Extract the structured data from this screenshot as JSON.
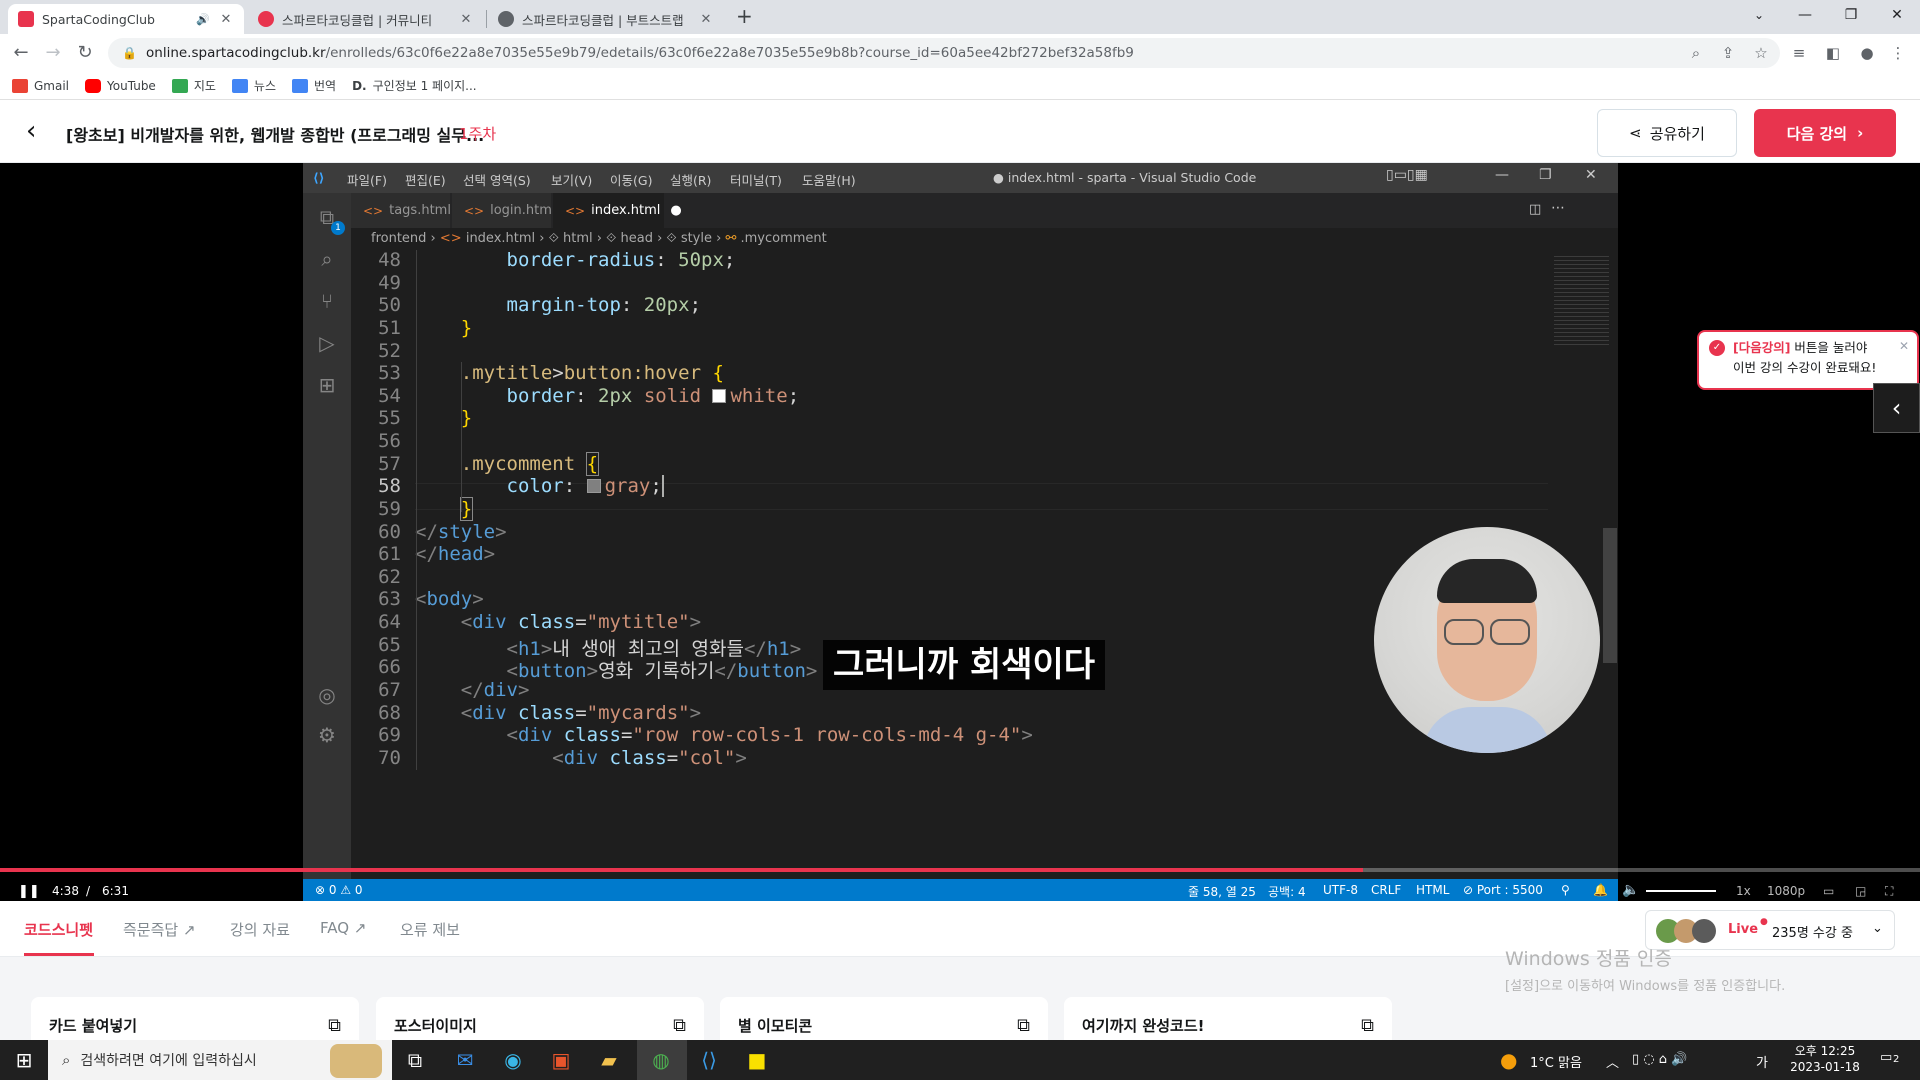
{
  "browser": {
    "tabs": [
      {
        "title": "SpartaCodingClub",
        "favicon_color": "#e8344e"
      },
      {
        "title": "스파르타코딩클럽 | 커뮤니티",
        "favicon_color": "#e8344e"
      },
      {
        "title": "스파르타코딩클럽 | 부트스트랩",
        "favicon_color": "#5f6368"
      }
    ],
    "new_tab": "+",
    "url_host": "online.spartacodingclub.kr",
    "url_path": "/enrolleds/63c0f6e22a8e7035e55e9b79/edetails/63c0f6e22a8e7035e55e9b8b?course_id=60a5ee42bf272bef32a58fb9",
    "bookmarks": [
      {
        "label": "Gmail",
        "color": "#ea4335"
      },
      {
        "label": "YouTube",
        "color": "#ff0000"
      },
      {
        "label": "지도",
        "color": "#34a853"
      },
      {
        "label": "뉴스",
        "color": "#4285f4"
      },
      {
        "label": "번역",
        "color": "#4285f4"
      },
      {
        "label": "구인정보 1 페이지...",
        "color": "#000000",
        "prefix": "D."
      }
    ]
  },
  "course": {
    "title": "[왕초보] 비개발자를 위한, 웹개발 종합반 (프로그래밍 실무...",
    "week": "1주차",
    "share_label": "공유하기",
    "next_label": "다음 강의",
    "tooltip_bold": "[다음강의]",
    "tooltip_rest": " 버튼을 눌러야",
    "tooltip_line2": "이번 강의 수강이 완료돼요!"
  },
  "vscode": {
    "menus": [
      "파일(F)",
      "편집(E)",
      "선택 영역(S)",
      "보기(V)",
      "이동(G)",
      "실행(R)",
      "터미널(T)",
      "도움말(H)"
    ],
    "window_title": "● index.html - sparta - Visual Studio Code",
    "tabs": [
      "tags.html",
      "login.html",
      "index.html"
    ],
    "breadcrumbs": [
      "frontend",
      "index.html",
      "html",
      "head",
      "style",
      ".mycomment"
    ],
    "explorer_badge": "1",
    "line_numbers": [
      "48",
      "49",
      "50",
      "51",
      "52",
      "53",
      "54",
      "55",
      "56",
      "57",
      "58",
      "59",
      "60",
      "61",
      "62",
      "63",
      "64",
      "65",
      "66",
      "67",
      "68",
      "69",
      "70"
    ],
    "status": {
      "problems": "⊗ 0 ⚠ 0",
      "position": "줄 58, 열 25",
      "spaces": "공백: 4",
      "encoding": "UTF-8",
      "eol": "CRLF",
      "language": "HTML",
      "port": "⊘ Port : 5500"
    }
  },
  "video": {
    "subtitle": "그러니까 회색이다",
    "current_time": "4:38",
    "separator": "/",
    "duration": "6:31",
    "progress_fraction": 0.71,
    "speed": "1x",
    "quality": "1080p"
  },
  "page": {
    "tabs": [
      "코드스니펫",
      "즉문즉답",
      "강의 자료",
      "FAQ",
      "오류 제보"
    ],
    "live_label": "Live",
    "live_count": "235명 수강 중",
    "cards": [
      "카드 붙여넣기",
      "포스터이미지",
      "별 이모티콘",
      "여기까지 완성코드!"
    ],
    "watermark_title": "Windows 정품 인증",
    "watermark_sub": "[설정]으로 이동하여 Windows를 정품 인증합니다."
  },
  "taskbar": {
    "search_placeholder": "검색하려면 여기에 입력하십시",
    "weather": "1°C  맑음",
    "time": "오후 12:25",
    "date": "2023-01-18",
    "notif_count": "2"
  },
  "colors": {
    "brand": "#e8344e",
    "vscode_status": "#007acc"
  }
}
